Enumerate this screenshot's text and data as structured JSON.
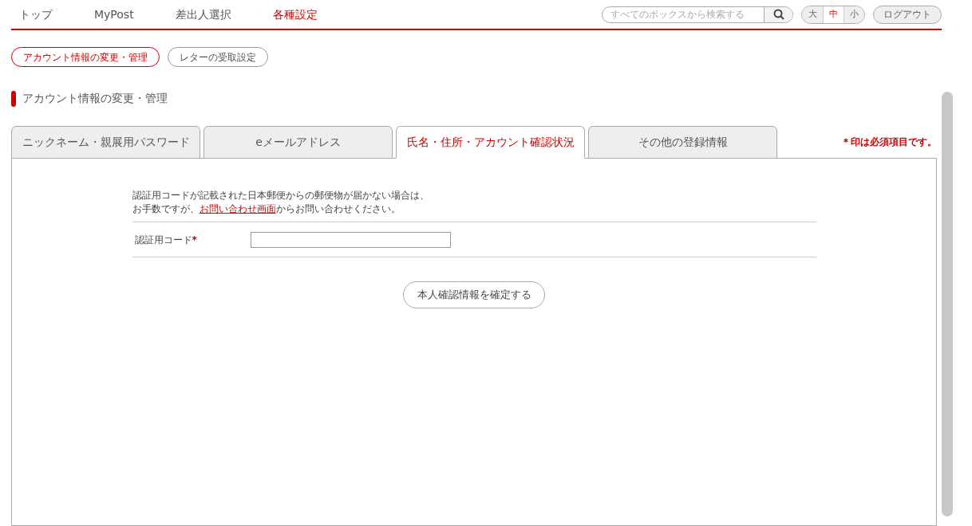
{
  "nav": {
    "items": [
      {
        "label": "トップ",
        "selected": false
      },
      {
        "label": "MyPost",
        "selected": false
      },
      {
        "label": "差出人選択",
        "selected": false
      },
      {
        "label": "各種設定",
        "selected": true
      }
    ],
    "search": {
      "placeholder": "すべてのボックスから検索する"
    },
    "font_sizes": [
      {
        "label": "大",
        "selected": false
      },
      {
        "label": "中",
        "selected": true
      },
      {
        "label": "小",
        "selected": false
      }
    ],
    "logout": "ログアウト"
  },
  "sub_nav": [
    {
      "label": "アカウント情報の変更・管理",
      "selected": true
    },
    {
      "label": "レターの受取設定",
      "selected": false
    }
  ],
  "section_title": "アカウント情報の変更・管理",
  "tabs": [
    {
      "label": "ニックネーム・親展用パスワード",
      "selected": false
    },
    {
      "label": "eメールアドレス",
      "selected": false
    },
    {
      "label": "氏名・住所・アカウント確認状況",
      "selected": true
    },
    {
      "label": "その他の登録情報",
      "selected": false
    }
  ],
  "required_note": "＊印は必須項目です。",
  "notice": {
    "line1": "認証用コードが記載された日本郵便からの郵便物が届かない場合は、",
    "line2_before": "お手数ですが、",
    "link": "お問い合わせ画面",
    "line2_after": "からお問い合わせください。"
  },
  "form": {
    "label": "認証用コード",
    "required_mark": "*"
  },
  "submit": "本人確認情報を確定する"
}
